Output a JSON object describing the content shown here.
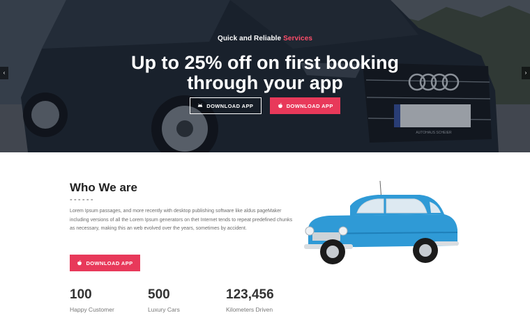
{
  "hero": {
    "kicker_main": "Quick and Reliable ",
    "kicker_accent": "Services",
    "title_line1": "Up to 25% off on first booking",
    "title_line2": "through your app",
    "buttons": [
      {
        "label": "DOWNLOAD APP",
        "icon": "android-icon",
        "style": "outline"
      },
      {
        "label": "DOWNLOAD APP",
        "icon": "apple-icon",
        "style": "solid"
      }
    ],
    "plate_text": "AUTOHAUS SCHEIER",
    "prev_arrow": "‹",
    "next_arrow": "›"
  },
  "about": {
    "title": "Who We are",
    "divider": "------",
    "text": "Lorem Ipsum passages, and more recently with desktop publishing software like aldus pageMaker including versions of all the Lorem Ipsum generators on thet Internet tends to repeat predefined chunks as necessary, making this an web evolved over the years, sometimes by accident.",
    "button_label": "DOWNLOAD APP",
    "button_icon": "apple-icon"
  },
  "stats": [
    {
      "value": "100",
      "label": "Happy Customer"
    },
    {
      "value": "500",
      "label": "Luxury Cars"
    },
    {
      "value": "123,456",
      "label": "Kilometers Driven"
    }
  ],
  "colors": {
    "accent": "#e8395a",
    "kicker_accent": "#ff4d6a",
    "classic_car_body": "#2f9ad6",
    "hero_overlay": "#141a24"
  }
}
